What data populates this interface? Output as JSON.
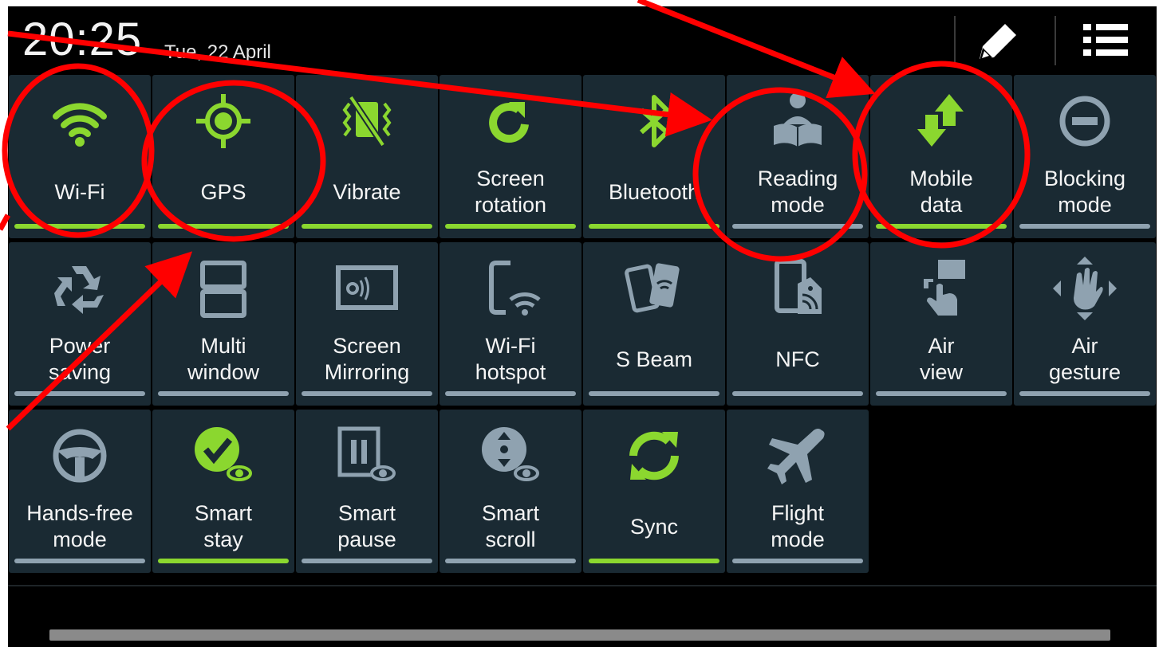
{
  "status_bar": {
    "time": "20:25",
    "date": "Tue, 22 April",
    "edit_icon": "pencil-icon",
    "settings_icon": "list-icon"
  },
  "colors": {
    "tile_bg": "#1a2a33",
    "on_green": "#8bd72f",
    "off_grey": "#8fa2b0",
    "annotation_red": "#ff0000"
  },
  "tiles": [
    {
      "label": "Wi-Fi",
      "on": true,
      "icon": "wifi-icon"
    },
    {
      "label": "GPS",
      "on": true,
      "icon": "gps-icon"
    },
    {
      "label": "Vibrate",
      "on": true,
      "icon": "vibrate-icon"
    },
    {
      "label": "Screen\nrotation",
      "on": true,
      "icon": "rotation-icon"
    },
    {
      "label": "Bluetooth",
      "on": true,
      "icon": "bluetooth-icon"
    },
    {
      "label": "Reading\nmode",
      "on": false,
      "icon": "reading-icon"
    },
    {
      "label": "Mobile\ndata",
      "on": true,
      "icon": "mobile-data-icon"
    },
    {
      "label": "Blocking\nmode",
      "on": false,
      "icon": "blocking-icon"
    },
    {
      "label": "Power\nsaving",
      "on": false,
      "icon": "recycle-icon"
    },
    {
      "label": "Multi\nwindow",
      "on": false,
      "icon": "multi-window-icon"
    },
    {
      "label": "Screen\nMirroring",
      "on": false,
      "icon": "mirroring-icon"
    },
    {
      "label": "Wi-Fi\nhotspot",
      "on": false,
      "icon": "hotspot-icon"
    },
    {
      "label": "S Beam",
      "on": false,
      "icon": "sbeam-icon"
    },
    {
      "label": "NFC",
      "on": false,
      "icon": "nfc-icon"
    },
    {
      "label": "Air\nview",
      "on": false,
      "icon": "air-view-icon"
    },
    {
      "label": "Air\ngesture",
      "on": false,
      "icon": "air-gesture-icon"
    },
    {
      "label": "Hands-free\nmode",
      "on": false,
      "icon": "steering-wheel-icon"
    },
    {
      "label": "Smart\nstay",
      "on": true,
      "icon": "smart-stay-icon"
    },
    {
      "label": "Smart\npause",
      "on": false,
      "icon": "smart-pause-icon"
    },
    {
      "label": "Smart\nscroll",
      "on": false,
      "icon": "smart-scroll-icon"
    },
    {
      "label": "Sync",
      "on": true,
      "icon": "sync-icon"
    },
    {
      "label": "Flight\nmode",
      "on": false,
      "icon": "airplane-icon"
    }
  ]
}
